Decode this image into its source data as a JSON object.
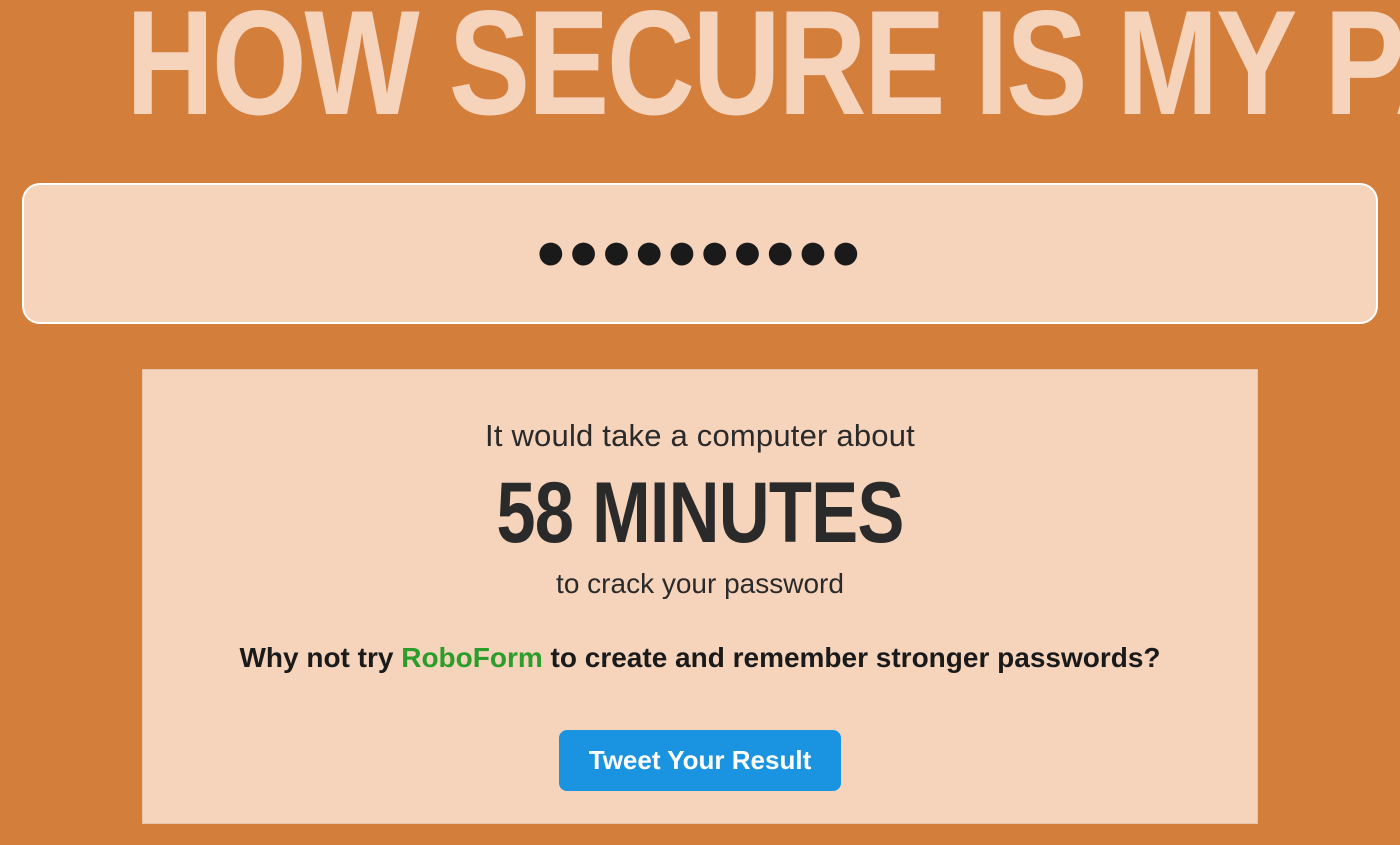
{
  "page": {
    "title": "HOW SECURE IS MY PASSWORD?"
  },
  "password": {
    "value": "••••••••••",
    "placeholder": ""
  },
  "result": {
    "lead": "It would take a computer about",
    "time": "58 MINUTES",
    "sub": "to crack your password",
    "suggestion_pre": "Why not try ",
    "suggestion_link": "RoboForm",
    "suggestion_post": " to create and remember stronger passwords?"
  },
  "actions": {
    "tweet_label": "Tweet Your Result"
  }
}
